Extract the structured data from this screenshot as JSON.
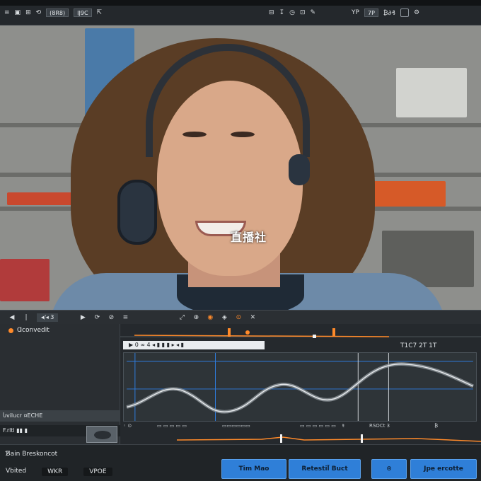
{
  "toolbar": {
    "left_items": [
      "≡",
      "▣",
      "⊞",
      "⟲",
      "⇱"
    ],
    "field_label": "(8R8)",
    "field_value": "IJ9C",
    "right_items": [
      "⊟",
      "↧",
      "◷",
      "⊡",
      "✎"
    ],
    "right_field": "YP",
    "right_field2": "7P",
    "right_text": "₿∂₰",
    "icon_names": [
      "menu-icon",
      "layers-icon",
      "grid-icon",
      "undo-icon",
      "export-icon"
    ]
  },
  "preview": {
    "watermark": "直播社"
  },
  "transport": {
    "field": "◂/◂ 3",
    "icons": [
      "◀",
      "❘",
      "▶",
      "⟳",
      "⊘",
      "≡",
      "⤢",
      "⊕",
      "◉",
      "◈",
      "⊙",
      "✕"
    ]
  },
  "left_panel": {
    "title": "Ɑconvedit",
    "row1": "Ⴑvilucr  ¤ECHE",
    "row2": "F.rltl   ▮▮ ▮"
  },
  "timeline": {
    "label": "▶ 0 ∞ 4  ◂ ▮ ▮ ▮  ▸ ◂ ▮",
    "right_label": "T1C7 2T 1T",
    "bottom_marks": [
      "◦ ⊙",
      "▭ ▭ ▭ ▭ ▭",
      "▭▭▭▭▭▭",
      "▭ ▭ ▭ ▭ ▭ ▭",
      "ŧ",
      "RSOCt  3",
      "₿"
    ]
  },
  "bottom_bar": {
    "title": "Ɓ̸ain Breskoncot",
    "left_items": [
      "Vbited",
      "WKR",
      "VPOE"
    ],
    "buttons": [
      "Tim Mao",
      "Retestil̃ Buct",
      "⊙",
      "Jpe ercotte"
    ]
  },
  "colors": {
    "accent": "#ff8a2a",
    "button_blue": "#2f7fd8",
    "panel_dark": "#25292d"
  }
}
